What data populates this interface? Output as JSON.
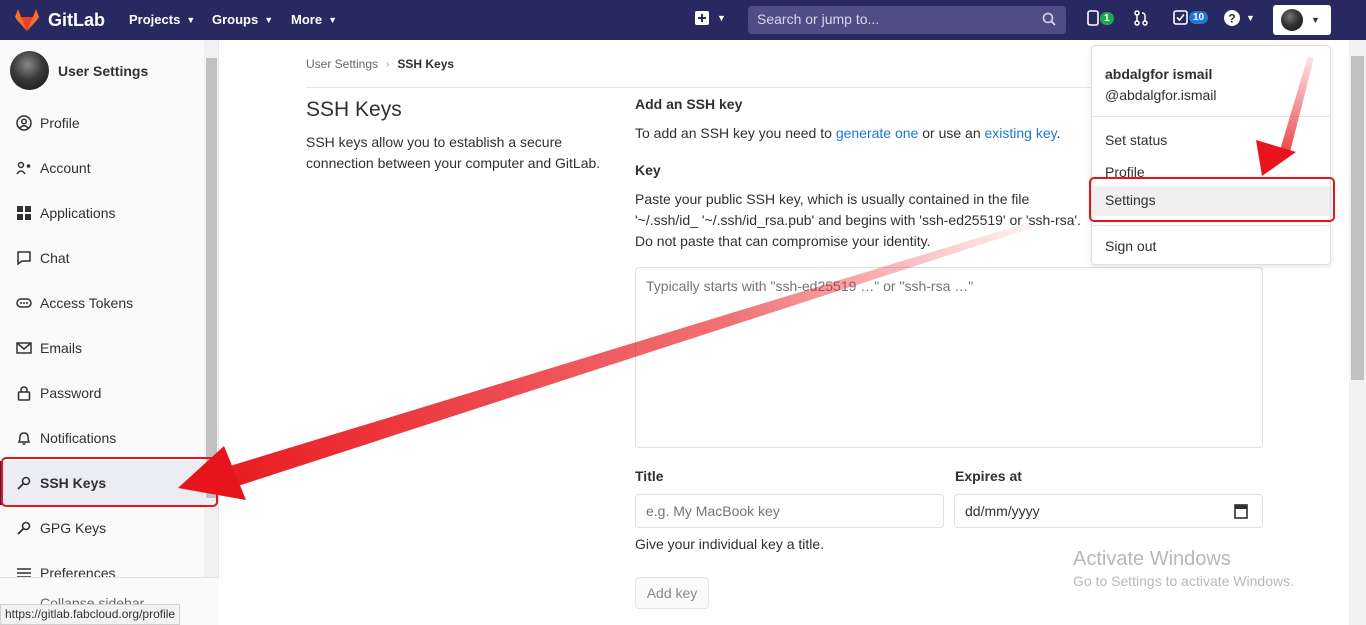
{
  "header": {
    "brand": "GitLab",
    "nav": [
      {
        "label": "Projects"
      },
      {
        "label": "Groups"
      },
      {
        "label": "More"
      }
    ],
    "search_placeholder": "Search or jump to...",
    "issues_count": "1",
    "todos_count": "10"
  },
  "sidebar": {
    "title": "User Settings",
    "items": [
      {
        "label": "Profile",
        "icon": "profile-icon"
      },
      {
        "label": "Account",
        "icon": "account-icon"
      },
      {
        "label": "Applications",
        "icon": "applications-icon"
      },
      {
        "label": "Chat",
        "icon": "chat-icon"
      },
      {
        "label": "Access Tokens",
        "icon": "token-icon"
      },
      {
        "label": "Emails",
        "icon": "email-icon"
      },
      {
        "label": "Password",
        "icon": "lock-icon"
      },
      {
        "label": "Notifications",
        "icon": "bell-icon"
      },
      {
        "label": "SSH Keys",
        "icon": "key-icon",
        "active": true
      },
      {
        "label": "GPG Keys",
        "icon": "key-icon"
      },
      {
        "label": "Preferences",
        "icon": "preferences-icon"
      }
    ],
    "collapse_label": "Collapse sidebar"
  },
  "statusbar": {
    "url": "https://gitlab.fabcloud.org/profile"
  },
  "breadcrumb": {
    "parent": "User Settings",
    "current": "SSH Keys"
  },
  "page": {
    "title": "SSH Keys",
    "description": "SSH keys allow you to establish a secure connection between your computer and GitLab."
  },
  "form": {
    "add_heading": "Add an SSH key",
    "add_text_before": "To add an SSH key you need to ",
    "generate_link": "generate one",
    "add_text_middle": " or use an ",
    "existing_link": "existing key",
    "add_text_after": ".",
    "key_label": "Key",
    "key_help": "Paste your public SSH key, which is usually contained in the file '~/.ssh/id_ '~/.ssh/id_rsa.pub' and begins with 'ssh-ed25519' or 'ssh-rsa'. Do not paste that can compromise your identity.",
    "key_placeholder": "Typically starts with \"ssh-ed25519 …\" or \"ssh-rsa …\"",
    "title_label": "Title",
    "title_placeholder": "e.g. My MacBook key",
    "expires_label": "Expires at",
    "expires_value": "dd/mm/yyyy",
    "title_help": "Give your individual key a title.",
    "submit_label": "Add key"
  },
  "user_menu": {
    "name": "abdalgfor ismail",
    "handle": "@abdalgfor.ismail",
    "items": [
      {
        "label": "Set status"
      },
      {
        "label": "Profile"
      },
      {
        "label": "Settings"
      },
      {
        "label": "Sign out"
      }
    ]
  },
  "watermark": {
    "title": "Activate Windows",
    "subtitle": "Go to Settings to activate Windows."
  },
  "colors": {
    "nav_bg": "#292961",
    "link": "#1f78d1",
    "annotation": "#e8141b"
  }
}
